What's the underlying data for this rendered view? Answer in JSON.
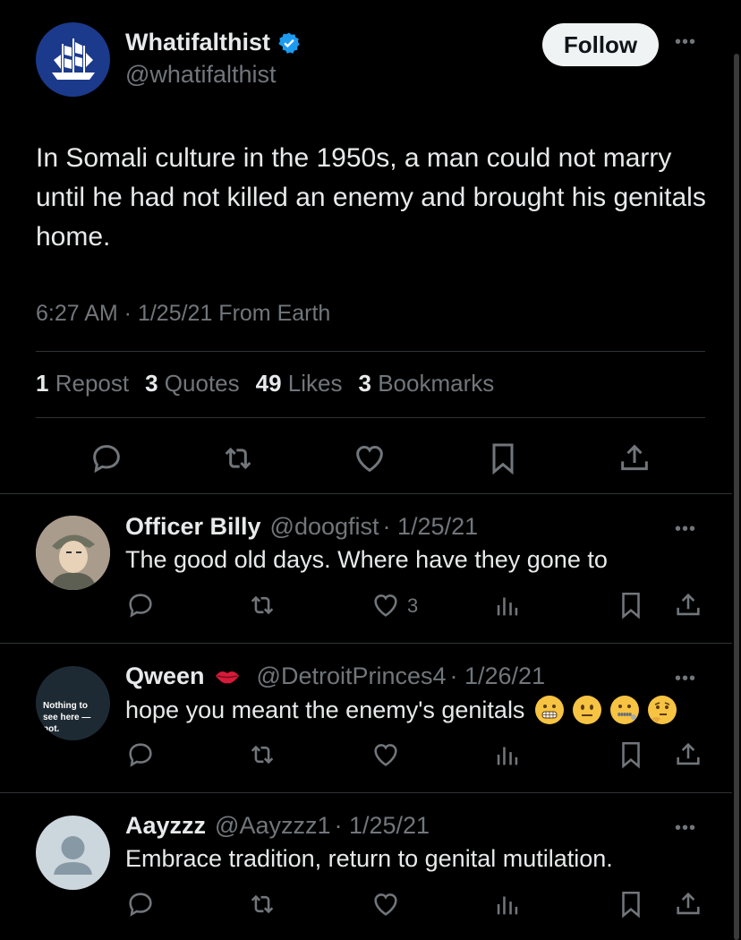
{
  "tweet": {
    "author_name": "Whatifalthist",
    "author_handle": "@whatifalthist",
    "follow_label": "Follow",
    "text": "In Somali culture in the 1950s, a man could not marry until he had not killed an enemy and brought his genitals home.",
    "meta": "6:27 AM · 1/25/21 From Earth",
    "stats": {
      "reposts_count": "1",
      "reposts_label": "Repost",
      "quotes_count": "3",
      "quotes_label": "Quotes",
      "likes_count": "49",
      "likes_label": "Likes",
      "bookmarks_count": "3",
      "bookmarks_label": "Bookmarks"
    }
  },
  "replies": [
    {
      "name": "Officer Billy",
      "handle": "@doogfist",
      "date": "· 1/25/21",
      "text": "The good old days. Where have they gone to",
      "likes": "3"
    },
    {
      "name": "Qween",
      "handle": "@DetroitPrinces4",
      "date": "· 1/26/21",
      "text": "hope you meant the enemy's genitals",
      "avatar_text": "Nothing to see here — not."
    },
    {
      "name": "Aayzzz",
      "handle": "@Aayzzz1",
      "date": "· 1/25/21",
      "text": "Embrace tradition, return to genital mutilation."
    }
  ],
  "colors": {
    "background": "#000000",
    "text": "#e7e9ea",
    "muted": "#71767b",
    "verified": "#1d9bf0",
    "divider": "#2f3336"
  },
  "icons": [
    "reply-icon",
    "repost-icon",
    "like-icon",
    "views-icon",
    "bookmark-icon",
    "share-icon",
    "more-icon",
    "verified-badge-icon"
  ]
}
